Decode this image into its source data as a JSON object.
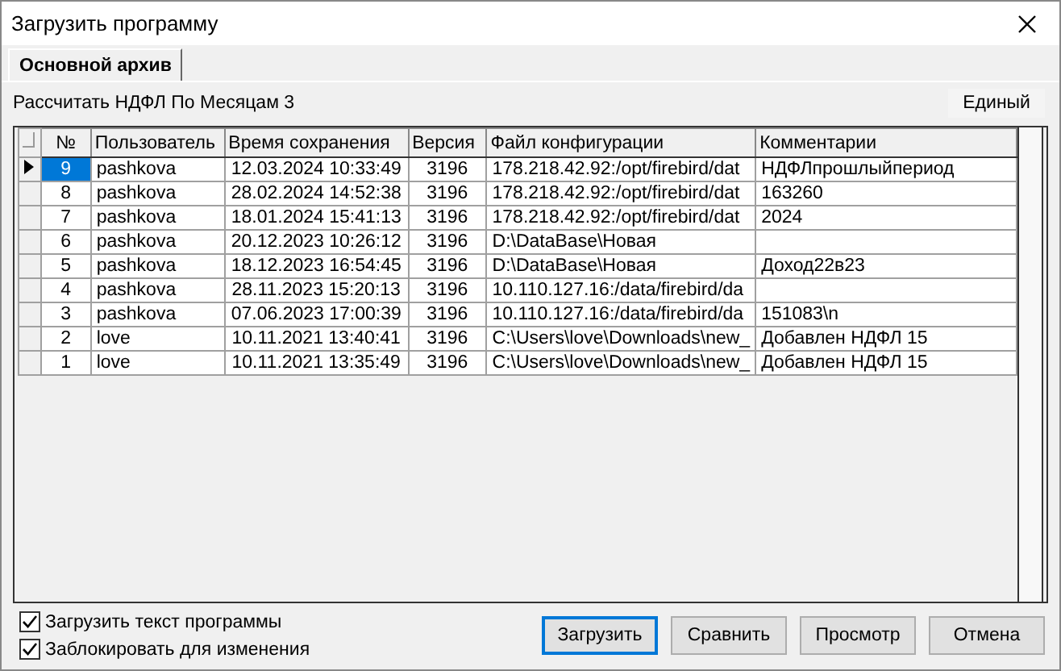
{
  "window": {
    "title": "Загрузить программу"
  },
  "tabs": [
    {
      "label": "Основной архив",
      "selected": true
    }
  ],
  "program_name": "Рассчитать НДФЛ По Месяцам 3",
  "mode_button": "Единый",
  "table": {
    "columns": [
      "№",
      "Пользователь",
      "Время сохранения",
      "Версия",
      "Файл конфигурации",
      "Комментарии"
    ],
    "rows": [
      {
        "selected": true,
        "cells": [
          "9",
          "pashkova",
          "12.03.2024 10:33:49",
          "3196",
          "178.218.42.92:/opt/firebird/dat",
          "НДФЛпрошлыйпериод"
        ]
      },
      {
        "selected": false,
        "cells": [
          "8",
          "pashkova",
          "28.02.2024 14:52:38",
          "3196",
          "178.218.42.92:/opt/firebird/dat",
          "163260"
        ]
      },
      {
        "selected": false,
        "cells": [
          "7",
          "pashkova",
          "18.01.2024 15:41:13",
          "3196",
          "178.218.42.92:/opt/firebird/dat",
          "2024"
        ]
      },
      {
        "selected": false,
        "cells": [
          "6",
          "pashkova",
          "20.12.2023 10:26:12",
          "3196",
          "D:\\DataBase\\Новая",
          ""
        ]
      },
      {
        "selected": false,
        "cells": [
          "5",
          "pashkova",
          "18.12.2023 16:54:45",
          "3196",
          "D:\\DataBase\\Новая",
          "Доход22в23"
        ]
      },
      {
        "selected": false,
        "cells": [
          "4",
          "pashkova",
          "28.11.2023 15:20:13",
          "3196",
          "10.110.127.16:/data/firebird/da",
          ""
        ]
      },
      {
        "selected": false,
        "cells": [
          "3",
          "pashkova",
          "07.06.2023 17:00:39",
          "3196",
          "10.110.127.16:/data/firebird/da",
          "151083\\n"
        ]
      },
      {
        "selected": false,
        "cells": [
          "2",
          "love",
          "10.11.2021 13:40:41",
          "3196",
          "C:\\Users\\love\\Downloads\\new_",
          "Добавлен НДФЛ 15"
        ]
      },
      {
        "selected": false,
        "cells": [
          "1",
          "love",
          "10.11.2021 13:35:49",
          "3196",
          "C:\\Users\\love\\Downloads\\new_",
          "Добавлен НДФЛ 15"
        ]
      }
    ]
  },
  "options": [
    {
      "label": "Загрузить текст программы",
      "checked": true
    },
    {
      "label": "Заблокировать для изменения",
      "checked": true
    }
  ],
  "buttons": [
    {
      "label": "Загрузить",
      "selected": true
    },
    {
      "label": "Сравнить",
      "selected": false
    },
    {
      "label": "Просмотр",
      "selected": false
    },
    {
      "label": "Отмена",
      "selected": false
    }
  ]
}
